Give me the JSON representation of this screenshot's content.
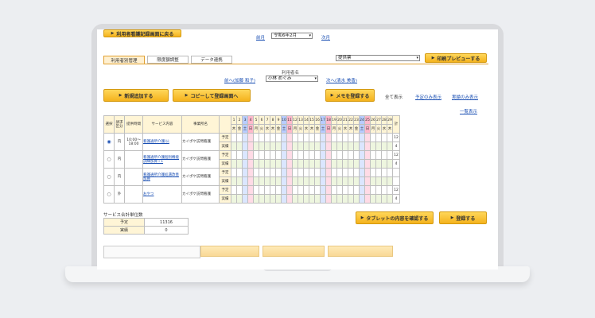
{
  "top": {
    "back_button": "利用者看護記録画面に戻る",
    "prev_month": "前月",
    "month_select": "令和6年2月",
    "next_month": "次月"
  },
  "tabs": [
    {
      "label": "利用者別管理"
    },
    {
      "label": "限度額調整"
    },
    {
      "label": "データ連携"
    }
  ],
  "header_right": {
    "select_placeholder": "提供票",
    "print_preview": "印刷プレビューする"
  },
  "user_nav": {
    "label": "利用者名",
    "prev": "前へ(加藤 和子)",
    "current": "小林 めぐみ",
    "next": "次へ(清水 美香)"
  },
  "actions": {
    "add_new": "新規追加する",
    "copy_register": "コピーして登録画面へ",
    "register_memo": "メモを登録する",
    "show_all": "全て表示",
    "plan_only": "予定のみ表示",
    "actual_only": "実績のみ表示",
    "list_view": "一覧表示"
  },
  "columns": {
    "select": "選択",
    "billing": "請求区分",
    "time": "提供時間",
    "service": "サービス内容",
    "office": "事業所名",
    "total": "計"
  },
  "days": [
    "1",
    "2",
    "3",
    "4",
    "5",
    "6",
    "7",
    "8",
    "9",
    "10",
    "11",
    "12",
    "13",
    "14",
    "15",
    "16",
    "17",
    "18",
    "19",
    "20",
    "21",
    "22",
    "23",
    "24",
    "25",
    "26",
    "27",
    "28",
    "29"
  ],
  "weekdays": [
    "木",
    "金",
    "土",
    "日",
    "月",
    "火",
    "水",
    "木",
    "金",
    "土",
    "日",
    "月",
    "火",
    "水",
    "木",
    "金",
    "土",
    "日",
    "月",
    "火",
    "水",
    "木",
    "金",
    "土",
    "日",
    "月",
    "火",
    "水",
    "木"
  ],
  "rows": [
    {
      "billing": "内",
      "time": "10:00～\n18:00",
      "service": "看護通所介護I公",
      "office": "カイポケ訪問看護",
      "plan_label": "予定",
      "actual_label": "実績",
      "plan_total": "12",
      "actual_total": "4",
      "selected": true
    },
    {
      "billing": "内",
      "time": "",
      "service": "看護通所介護個別機能訓練加算 I 1",
      "office": "カイポケ訪問看護",
      "plan_label": "予定",
      "actual_label": "実績",
      "plan_total": "12",
      "actual_total": "4",
      "selected": false
    },
    {
      "billing": "内",
      "time": "",
      "service": "看護通所介護処遇改善加算",
      "office": "カイポケ訪問看護",
      "plan_label": "予定",
      "actual_label": "実績",
      "plan_total": "",
      "actual_total": "",
      "selected": false
    },
    {
      "billing": "外",
      "time": "",
      "service": "おやつ",
      "office": "カイポケ訪問看護",
      "plan_label": "予定",
      "actual_label": "実績",
      "plan_total": "12",
      "actual_total": "4",
      "selected": false
    }
  ],
  "summary": {
    "title": "サービス合計単位数",
    "plan_label": "予定",
    "plan_value": "11316",
    "actual_label": "実績",
    "actual_value": "0"
  },
  "bottom_actions": {
    "confirm_tablet": "タブレットの内容を確認する",
    "register": "登録する"
  }
}
